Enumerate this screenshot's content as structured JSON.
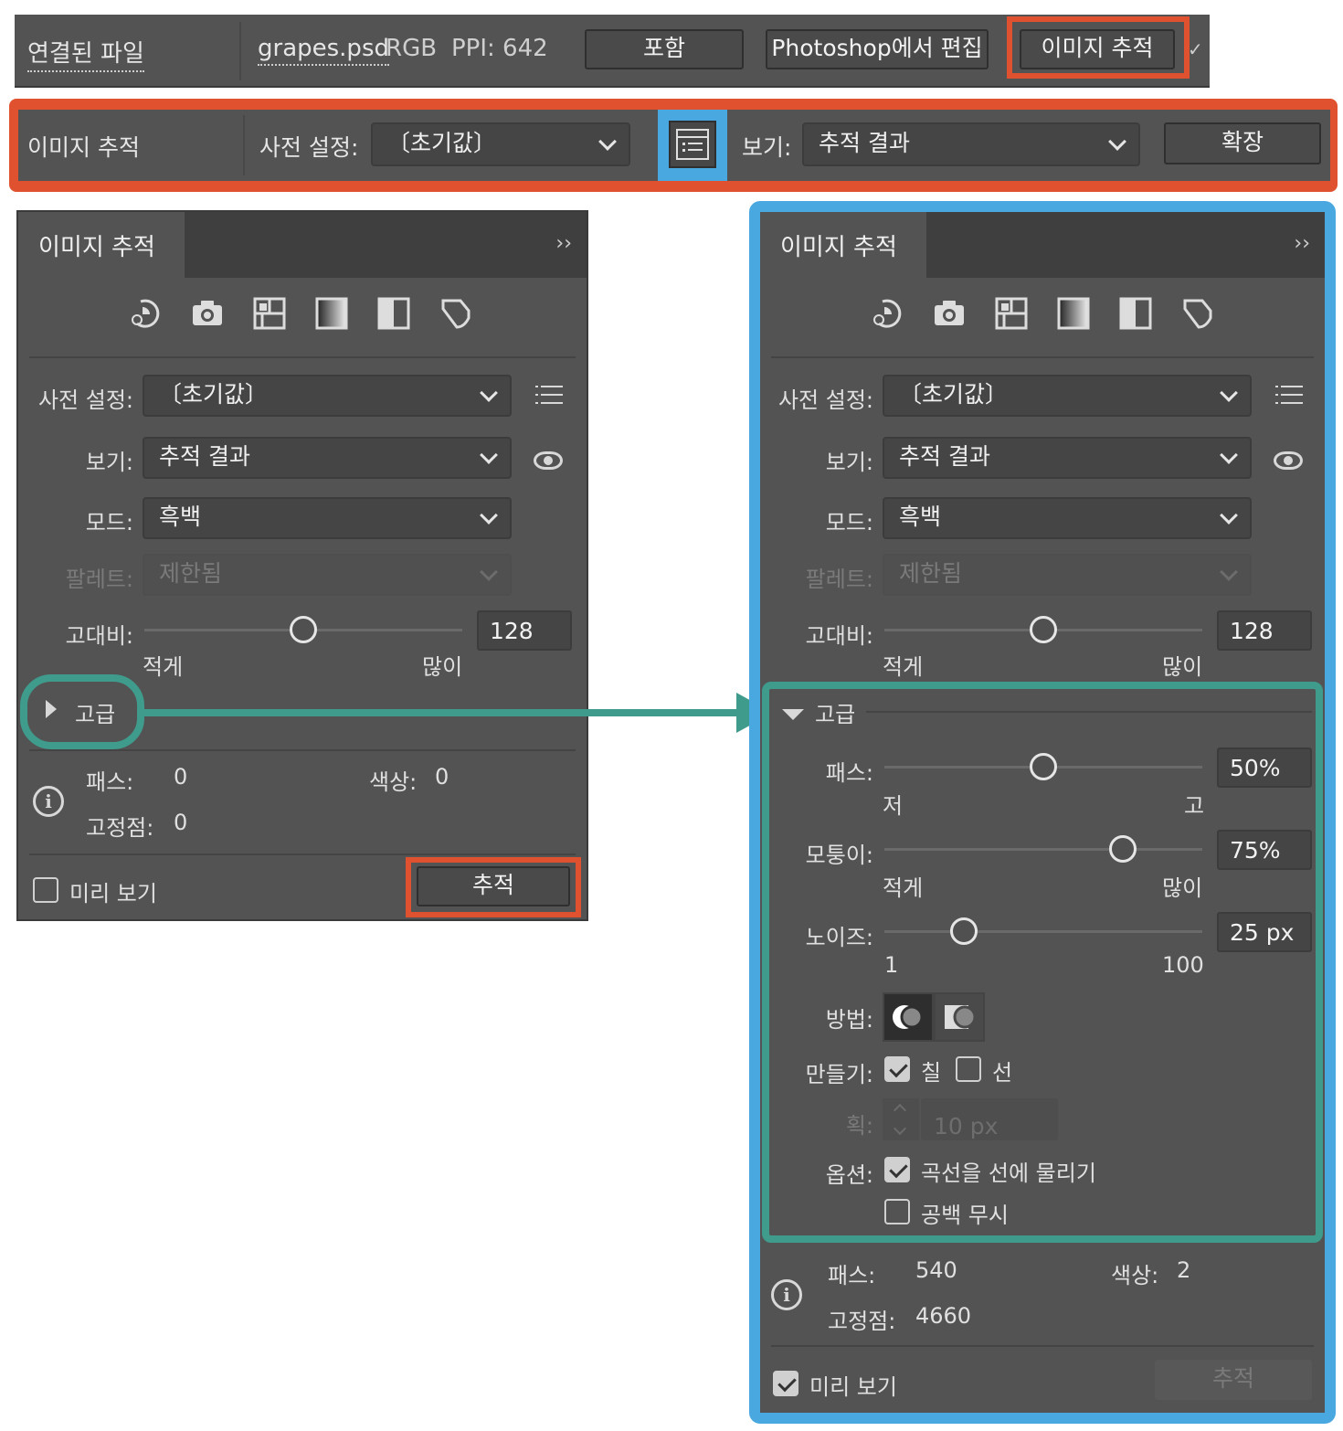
{
  "control_bar": {
    "linked_file": "연결된 파일",
    "filename": "grapes.psd",
    "color_mode": "RGB",
    "ppi": "PPI:  642",
    "embed_button": "포함",
    "edit_photoshop_button": "Photoshop에서 편집",
    "image_trace_button": "이미지 추적",
    "extra": "✓"
  },
  "trace_bar": {
    "title": "이미지 추적",
    "preset_label": "사전 설정:",
    "preset_value": "〔초기값〕",
    "view_label": "보기:",
    "view_value": "추적 결과",
    "expand_button": "확장"
  },
  "left_panel": {
    "tab": "이미지 추적",
    "preset_label": "사전 설정:",
    "preset_value": "〔초기값〕",
    "view_label": "보기:",
    "view_value": "추적 결과",
    "mode_label": "모드:",
    "mode_value": "흑백",
    "palette_label": "팔레트:",
    "palette_value": "제한됨",
    "threshold_label": "고대비:",
    "threshold_value": "128",
    "threshold_min": "적게",
    "threshold_max": "많이",
    "advanced": "고급",
    "paths_label": "패스:",
    "paths_value": "0",
    "colors_label": "색상:",
    "colors_value": "0",
    "anchors_label": "고정점:",
    "anchors_value": "0",
    "preview": "미리 보기",
    "trace_button": "추적"
  },
  "right_panel": {
    "tab": "이미지 추적",
    "preset_label": "사전 설정:",
    "preset_value": "〔초기값〕",
    "view_label": "보기:",
    "view_value": "추적 결과",
    "mode_label": "모드:",
    "mode_value": "흑백",
    "palette_label": "팔레트:",
    "palette_value": "제한됨",
    "threshold_label": "고대비:",
    "threshold_value": "128",
    "threshold_min": "적게",
    "threshold_max": "많이",
    "advanced": "고급",
    "paths_slider_label": "패스:",
    "paths_slider_value": "50%",
    "paths_min": "저",
    "paths_max": "고",
    "corners_label": "모퉁이:",
    "corners_value": "75%",
    "corners_min": "적게",
    "corners_max": "많이",
    "noise_label": "노이즈:",
    "noise_value": "25 px",
    "noise_min": "1",
    "noise_max": "100",
    "method_label": "방법:",
    "create_label": "만들기:",
    "fills": "칠",
    "strokes": "선",
    "stroke_label": "획:",
    "stroke_value": "10 px",
    "options_label": "옵션:",
    "snap_curves": "곡선을 선에 물리기",
    "ignore_white": "공백 무시",
    "paths_label": "패스:",
    "paths_value": "540",
    "colors_label": "색상:",
    "colors_value": "2",
    "anchors_label": "고정점:",
    "anchors_value": "4660",
    "preview": "미리 보기",
    "trace_button": "추적"
  },
  "state": {
    "threshold_fraction": 0.5,
    "paths_fraction": 0.5,
    "corners_fraction": 0.75,
    "noise_fraction": 0.25,
    "left_preview_checked": false,
    "right_preview_checked": true,
    "fills_checked": true,
    "strokes_checked": false,
    "snap_curves_checked": true,
    "ignore_white_checked": false
  },
  "colors": {
    "highlight_red": "#e0522f",
    "highlight_blue": "#4aa8e0",
    "highlight_teal": "#3f9b8c",
    "panel_bg": "#535353"
  },
  "icons": [
    "auto-color-icon",
    "camera-icon",
    "grid-icon",
    "gradient-icon",
    "half-square-icon",
    "outline-icon",
    "list-icon",
    "eye-icon",
    "info-icon",
    "chevron-down-icon",
    "double-chevron-icon",
    "disclosure-triangle-icon"
  ]
}
